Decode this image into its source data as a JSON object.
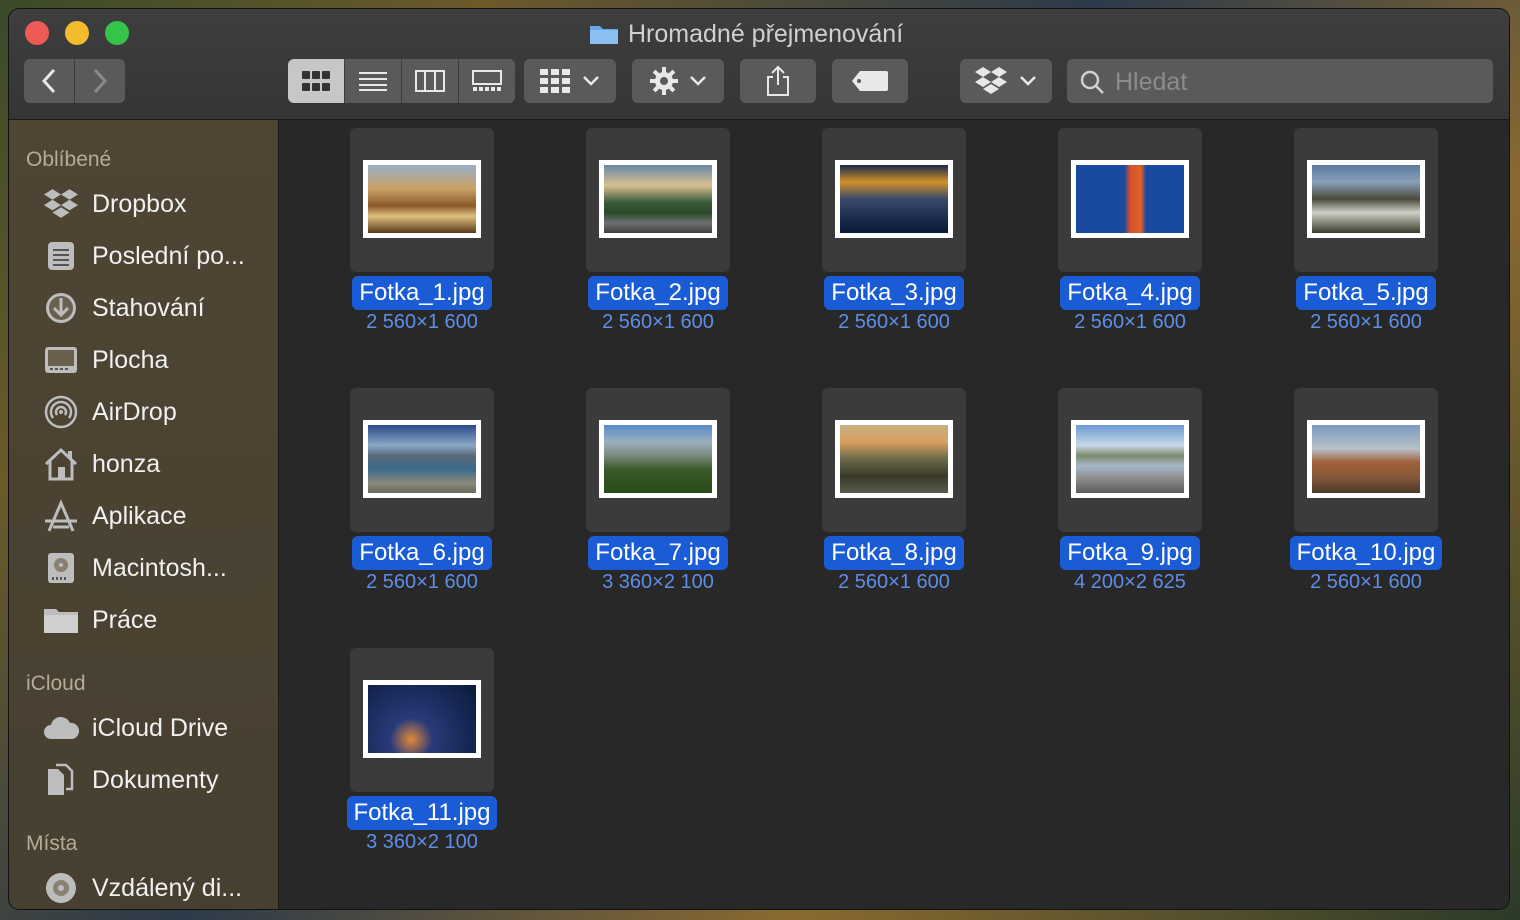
{
  "window": {
    "title": "Hromadné přejmenování"
  },
  "toolbar": {
    "search_placeholder": "Hledat"
  },
  "sidebar": {
    "sections": [
      {
        "heading": "Oblíbené",
        "items": [
          "Dropbox",
          "Poslední po...",
          "Stahování",
          "Plocha",
          "AirDrop",
          "honza",
          "Aplikace",
          "Macintosh...",
          "Práce"
        ]
      },
      {
        "heading": "iCloud",
        "items": [
          "iCloud Drive",
          "Dokumenty"
        ]
      },
      {
        "heading": "Místa",
        "items": [
          "Vzdálený di..."
        ]
      }
    ]
  },
  "files": [
    {
      "name": "Fotka_1.jpg",
      "dims": "2 560×1 600"
    },
    {
      "name": "Fotka_2.jpg",
      "dims": "2 560×1 600"
    },
    {
      "name": "Fotka_3.jpg",
      "dims": "2 560×1 600"
    },
    {
      "name": "Fotka_4.jpg",
      "dims": "2 560×1 600"
    },
    {
      "name": "Fotka_5.jpg",
      "dims": "2 560×1 600"
    },
    {
      "name": "Fotka_6.jpg",
      "dims": "2 560×1 600"
    },
    {
      "name": "Fotka_7.jpg",
      "dims": "3 360×2 100"
    },
    {
      "name": "Fotka_8.jpg",
      "dims": "2 560×1 600"
    },
    {
      "name": "Fotka_9.jpg",
      "dims": "4 200×2 625"
    },
    {
      "name": "Fotka_10.jpg",
      "dims": "2 560×1 600"
    },
    {
      "name": "Fotka_11.jpg",
      "dims": "3 360×2 100"
    }
  ],
  "colors": {
    "selection": "#1a5bd6",
    "dims_text": "#5c8fe8",
    "close": "#ee5b56",
    "minimize": "#f3bc2e",
    "zoom": "#34c448"
  }
}
